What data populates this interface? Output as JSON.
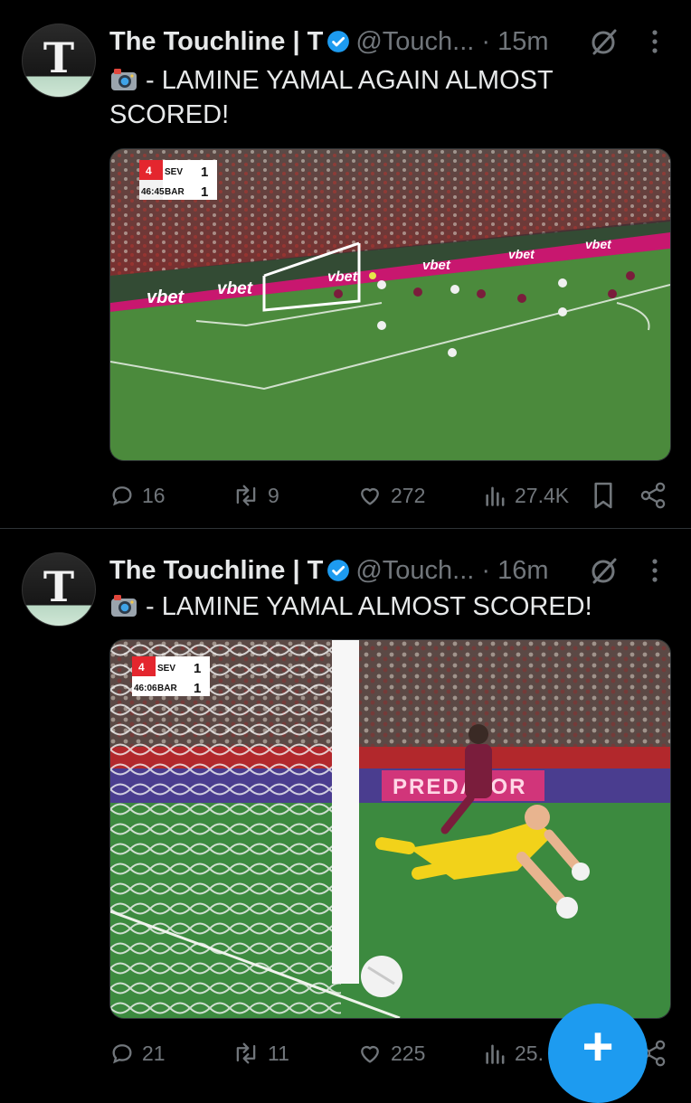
{
  "tweets": [
    {
      "author_name": "The Touchline | T",
      "handle": "@Touch...",
      "time": "· 15m",
      "text": "- LAMINE YAMAL AGAIN ALMOST SCORED!",
      "media": {
        "scorebug": {
          "home": "SEV",
          "away": "BAR",
          "home_score": "1",
          "away_score": "1",
          "clock": "46:45"
        },
        "sponsor": "vbet"
      },
      "stats": {
        "replies": "16",
        "reposts": "9",
        "likes": "272",
        "views": "27.4K"
      }
    },
    {
      "author_name": "The Touchline | T",
      "handle": "@Touch...",
      "time": "· 16m",
      "text": "- LAMINE YAMAL ALMOST SCORED!",
      "media": {
        "scorebug": {
          "home": "SEV",
          "away": "BAR",
          "home_score": "1",
          "away_score": "1",
          "clock": "46:06"
        },
        "board": "PREDATOR"
      },
      "stats": {
        "replies": "21",
        "reposts": "11",
        "likes": "225",
        "views": "25."
      }
    }
  ],
  "avatar_letter": "T",
  "compose_button": "+",
  "colors": {
    "accent": "#1d9bf0",
    "muted": "#71767b",
    "background": "#000000"
  },
  "icons": [
    "camera-icon",
    "verified-badge-icon",
    "mute-icon",
    "more-icon",
    "reply-icon",
    "repost-icon",
    "like-icon",
    "views-icon",
    "bookmark-icon",
    "share-icon"
  ]
}
